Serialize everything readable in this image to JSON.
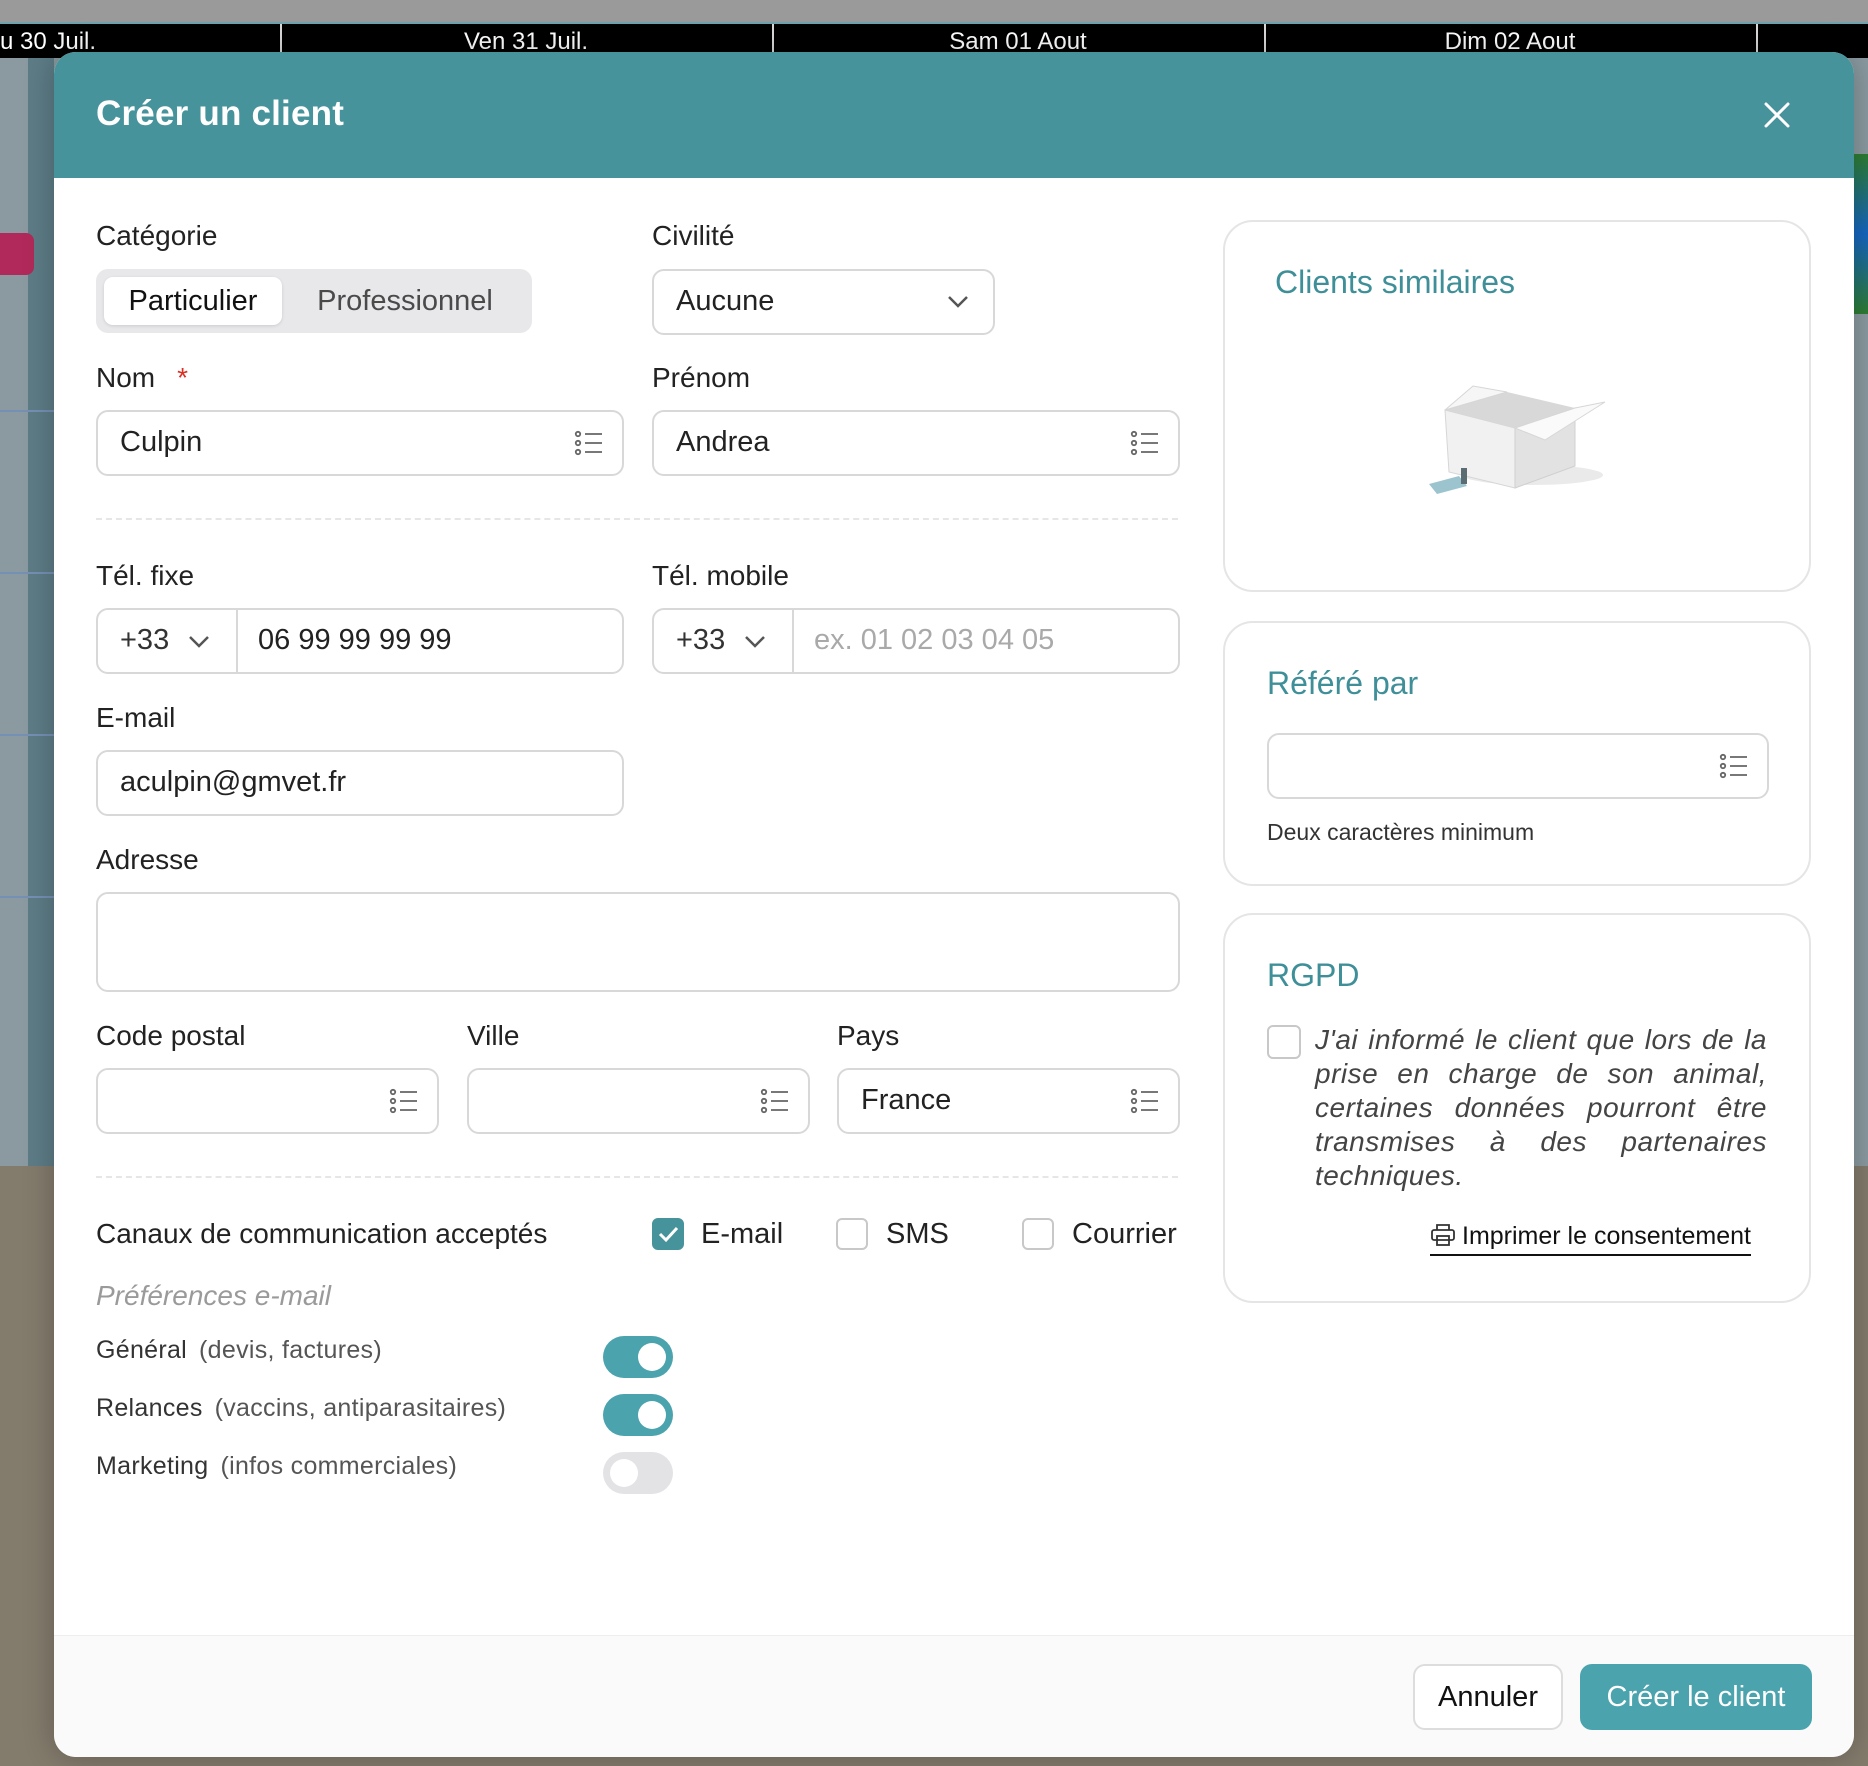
{
  "calendar": {
    "days": [
      "u 30 Juil.",
      "Ven 31 Juil.",
      "Sam 01 Aout",
      "Dim 02 Aout"
    ]
  },
  "modal": {
    "title": "Créer un client",
    "close_icon": "close-icon"
  },
  "form": {
    "category": {
      "label": "Catégorie",
      "options": [
        "Particulier",
        "Professionnel"
      ],
      "selected": "Particulier"
    },
    "civility": {
      "label": "Civilité",
      "value": "Aucune"
    },
    "last_name": {
      "label": "Nom",
      "required_mark": "*",
      "value": "Culpin"
    },
    "first_name": {
      "label": "Prénom",
      "value": "Andrea"
    },
    "landline": {
      "label": "Tél. fixe",
      "country_code": "+33",
      "value": "06 99 99 99 99"
    },
    "mobile": {
      "label": "Tél. mobile",
      "country_code": "+33",
      "value": "",
      "placeholder": "ex. 01 02 03 04 05"
    },
    "email": {
      "label": "E-mail",
      "value": "aculpin@gmvet.fr"
    },
    "address": {
      "label": "Adresse",
      "value": ""
    },
    "postal_code": {
      "label": "Code postal",
      "value": ""
    },
    "city": {
      "label": "Ville",
      "value": ""
    },
    "country": {
      "label": "Pays",
      "value": "France"
    },
    "channels": {
      "label": "Canaux de communication acceptés",
      "options": [
        {
          "label": "E-mail",
          "checked": true
        },
        {
          "label": "SMS",
          "checked": false
        },
        {
          "label": "Courrier",
          "checked": false
        }
      ]
    },
    "email_prefs": {
      "title": "Préférences e-mail",
      "items": [
        {
          "label": "Général",
          "detail": "(devis, factures)",
          "enabled": true
        },
        {
          "label": "Relances",
          "detail": "(vaccins, antiparasitaires)",
          "enabled": true
        },
        {
          "label": "Marketing",
          "detail": "(infos commerciales)",
          "enabled": false
        }
      ]
    }
  },
  "side": {
    "similar": {
      "title": "Clients similaires",
      "illustration": "empty-box-illustration"
    },
    "referred": {
      "title": "Référé par",
      "value": "",
      "hint": "Deux caractères minimum"
    },
    "rgpd": {
      "title": "RGPD",
      "checked": false,
      "text": "J'ai informé le client que lors de la prise en charge de son animal, certaines données pourront être transmises à des partenaires techniques.",
      "print_label": "Imprimer le consentement",
      "print_icon": "printer-icon"
    }
  },
  "footer": {
    "cancel": "Annuler",
    "submit": "Créer le client"
  },
  "colors": {
    "accent": "#47939c",
    "toggle_on": "#4aa3ad",
    "required": "#d93025"
  }
}
